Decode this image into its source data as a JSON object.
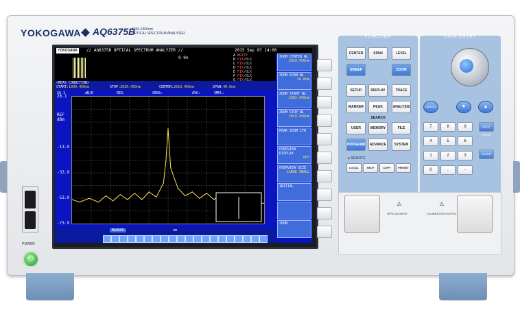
{
  "device": {
    "brand": "YOKOGAWA",
    "model": "AQ6375B",
    "model_subtitle": [
      "1200-2400nm",
      "OPTICAL SPECTRUM ANALYZER"
    ],
    "power_label": "POWER"
  },
  "screen": {
    "header": "// AQ6375B OPTICAL SPECTRUM ANALYZER //",
    "datetime": "2015 Sep 07 14:00",
    "mini_label": "9-9n",
    "brand_small": "YOKOGAWA",
    "meas_condition_title": "<MEAS CONDITION>",
    "start_label": "START:",
    "start_value": "1999.450nm",
    "stop_label": "STOP:",
    "stop_value": "2020.450nm",
    "center_label": "CENTER:",
    "center_value": "2010.450nm",
    "span_label": "SPAN:",
    "span_value": "40.0nm",
    "ref_level": "26.1",
    "scale_unit": "dB/D",
    "res_label": "RES:",
    "avg_label": "AVG:",
    "smpl_label": "SMPL:",
    "sens_label": "SENS:",
    "ref_label": "REF",
    "dbm_label": "dBm",
    "y_ticks": [
      "26.1",
      "-13.9",
      "-33.9",
      "-53.9",
      "-73.9"
    ],
    "bottom_unit": "nm",
    "marker_label": "MARKER",
    "memory_rows": [
      {
        "trace": "A",
        "state": "WRITE"
      },
      {
        "trace": "B",
        "state": "FIX",
        "sub": "/BLK"
      },
      {
        "trace": "C",
        "state": "FIX",
        "sub": "/BLK"
      },
      {
        "trace": "D",
        "state": "FIX",
        "sub": "/BLK"
      },
      {
        "trace": "E",
        "state": "FIX",
        "sub": "/BLK"
      },
      {
        "trace": "F",
        "state": "FIX",
        "sub": "/BLK"
      },
      {
        "trace": "G",
        "state": "FIX",
        "sub": "/BLK"
      }
    ],
    "softkeys": [
      {
        "label": "ZOOM CENTER WL",
        "value": "2010.450nm"
      },
      {
        "label": "ZOOM SPAN WL",
        "value": "16.0nm"
      },
      {
        "label": "ZOOM START WL",
        "value": "2002.450nm"
      },
      {
        "label": "ZOOM STOP WL",
        "value": "2018.450nm"
      },
      {
        "label": "PEAK ZOOM CTR",
        "value": ""
      },
      {
        "label": "OVERVIEW DISPLAY",
        "value": "OFF"
      },
      {
        "label": "OVERVIEW SIZE",
        "value": "LARGE SMALL"
      },
      {
        "label": "INITIAL",
        "value": ""
      },
      {
        "label": "",
        "value": ""
      },
      {
        "label": "ZOOM",
        "value": ""
      }
    ],
    "chart_data": {
      "type": "line",
      "title": "",
      "xlabel": "",
      "ylabel": "dBm",
      "xlim": [
        1990.45,
        2030.45
      ],
      "ylim": [
        -73.9,
        26.1
      ],
      "x": [
        1990.45,
        1992,
        1994,
        1996,
        1997.5,
        1999,
        2000.5,
        2002,
        2003.5,
        2005,
        2006.5,
        2008,
        2009.5,
        2010.0,
        2010.45,
        2011,
        2012.5,
        2014,
        2015.5,
        2017,
        2018.5,
        2020,
        2021.5,
        2023,
        2024.5,
        2026,
        2027.5,
        2029,
        2030.45
      ],
      "series": [
        {
          "values": [
            -55,
            -57,
            -54,
            -57,
            -52,
            -56,
            -51,
            -55,
            -50,
            -55,
            -49,
            -53,
            -42,
            -25,
            1,
            -30,
            -46,
            -52,
            -49,
            -54,
            -50,
            -55,
            -51,
            -56,
            -52,
            -56,
            -53,
            -57,
            -58
          ]
        }
      ]
    }
  },
  "function_panel": {
    "title": "FUNCTION",
    "keys": [
      "CENTER",
      "SPAN",
      "LEVEL",
      "SWEEP",
      "ZOOM",
      "SETUP",
      "DISPLAY",
      "TRACE",
      "MARKER",
      "PEAK SEARCH",
      "ANALYSIS",
      "USER",
      "MEMORY",
      "FILE",
      "PROGRAM",
      "ADVANCE",
      "SYSTEM",
      "LOCAL",
      "HELP",
      "COPY",
      "PRESET"
    ],
    "remote_label": "REMOTE"
  },
  "data_entry_panel": {
    "title": "DATA ENTRY",
    "keys": [
      "7",
      "8",
      "9",
      "4",
      "5",
      "6",
      "1",
      "2",
      "3",
      "0",
      ".",
      "-"
    ],
    "right_keys": [
      "BACK SPACE",
      "ENTER"
    ],
    "cancel_label": "CANCEL",
    "down_arrow": "▼",
    "up_arrow": "▲"
  },
  "connectors": {
    "optical_input": "OPTICAL INPUT",
    "calibration_output": "CALIBRATION OUTPUT",
    "warning": "⚠"
  },
  "colors": {
    "screen_bg": "#0a14c0",
    "trace": "#ffe35a",
    "panel": "#a8c2e2",
    "brand": "#1b2f66"
  }
}
